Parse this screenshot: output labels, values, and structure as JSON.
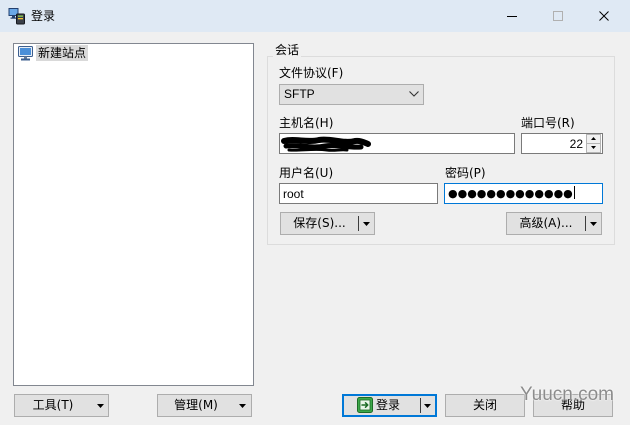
{
  "window": {
    "title": "登录",
    "app_icon": "winscp-app-icon",
    "minimize_icon": "minimize-icon",
    "maximize_icon": "maximize-icon",
    "close_icon": "close-icon"
  },
  "site_tree": {
    "items": [
      {
        "label": "新建站点",
        "icon": "new-site-computer-icon",
        "selected": true
      }
    ]
  },
  "tree_buttons": {
    "tools_label": "工具(T)",
    "manage_label": "管理(M)"
  },
  "session": {
    "group_title": "会话",
    "protocol_label": "文件协议(F)",
    "protocol_value": "SFTP",
    "host_label": "主机名(H)",
    "port_label": "端口号(R)",
    "port_value": "22",
    "username_label": "用户名(U)",
    "username_value": "root",
    "password_label": "密码(P)",
    "password_masked": "●●●●●●●●●●●●●",
    "save_label": "保存(S)...",
    "advanced_label": "高级(A)..."
  },
  "actions": {
    "login_label": "登录",
    "login_icon": "login-icon",
    "close_label": "关闭",
    "help_label": "帮助"
  },
  "watermark": "Yuucn.com",
  "colors": {
    "dialog-bg": "#f0f0f0",
    "titlebar-bg": "#dfe9f4",
    "button-bg": "#e1e1e1",
    "button-border": "#adadad",
    "input-border": "#7a7a7a",
    "focus-accent": "#0078d7",
    "tree-border": "#828790",
    "tree-selection": "#d9d9d9",
    "group-border": "#dcdcdc",
    "watermark": "#8c8c8c"
  }
}
